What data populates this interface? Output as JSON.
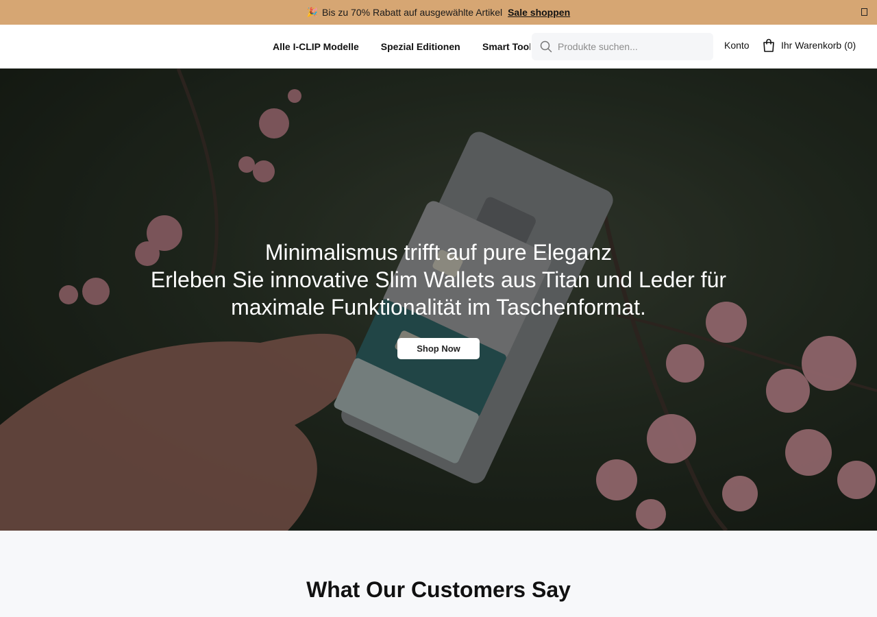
{
  "announcement": {
    "text": "Bis zu 70% Rabatt auf ausgewählte Artikel",
    "link_label": "Sale shoppen",
    "icon": "party-popper-icon",
    "close_icon": "close-icon"
  },
  "header": {
    "nav": [
      {
        "label": "Alle I-CLIP Modelle"
      },
      {
        "label": "Spezial Editionen"
      },
      {
        "label": "Smart Tool"
      }
    ],
    "search": {
      "placeholder": "Produkte suchen...",
      "value": "",
      "icon": "search-icon"
    },
    "account_label": "Konto",
    "cart": {
      "label": "Ihr Warenkorb (0)",
      "icon": "shopping-bag-icon"
    }
  },
  "hero": {
    "title": "Minimalismus trifft auf pure Eleganz",
    "subtitle": "Erleben Sie innovative Slim Wallets aus Titan und Leder für maximale Funktionalität im Taschenformat.",
    "button_label": "Shop Now"
  },
  "reviews": {
    "heading": "What Our Customers Say"
  },
  "colors": {
    "announcement_bg": "#d6a673",
    "hero_bg": "#273024",
    "reviews_bg": "#f7f8fa",
    "blossom": "#c98a92"
  }
}
